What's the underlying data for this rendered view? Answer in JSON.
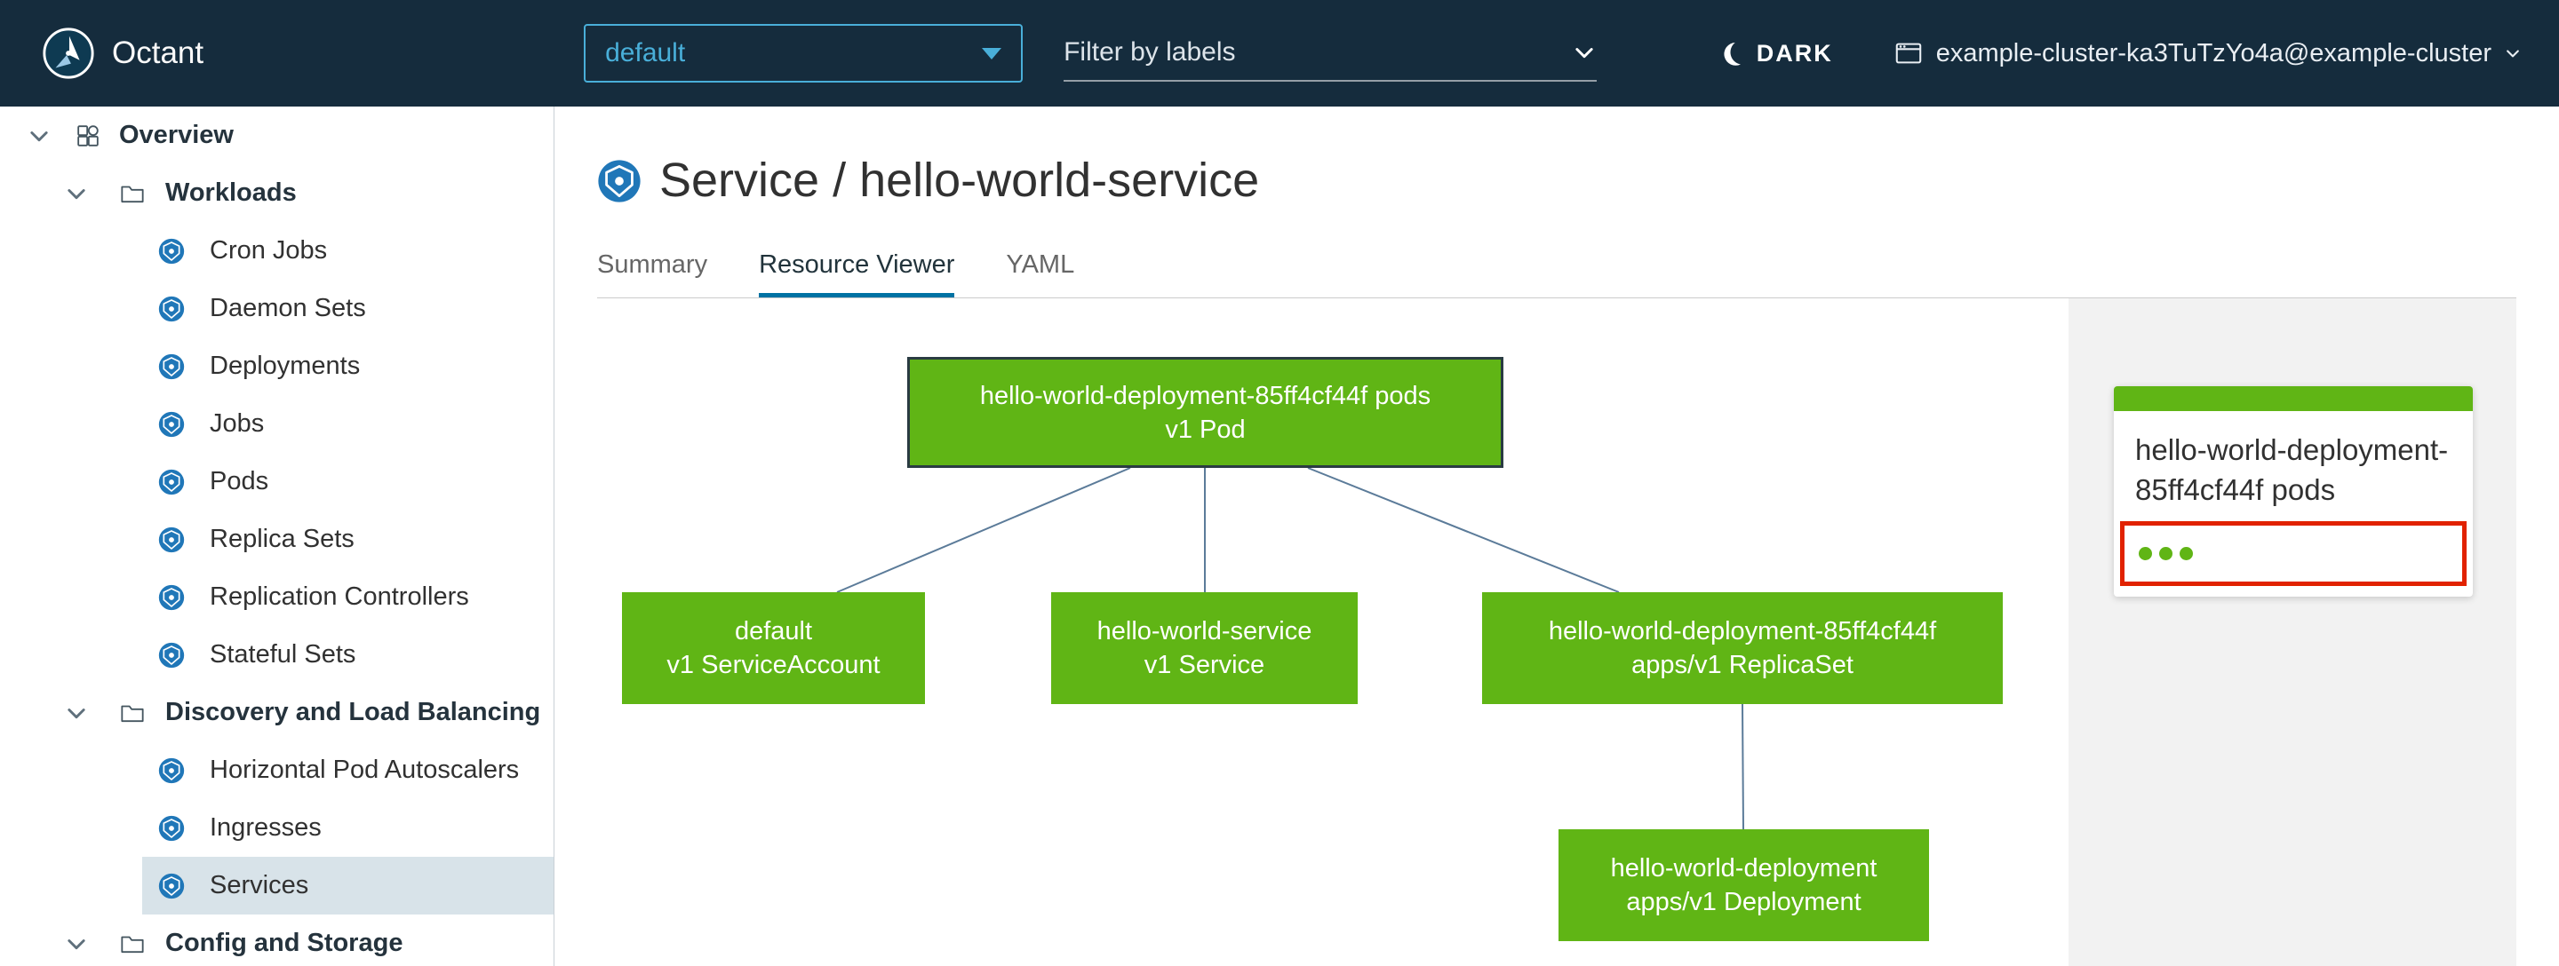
{
  "colors": {
    "header_bg": "#152c3d",
    "accent_blue": "#49afd9",
    "node_green": "#60b515",
    "selection_red": "#e12200",
    "tab_active_underline": "#0072a3",
    "sidebar_selected_bg": "#d8e3e9",
    "k8s_icon_blue": "#2077b8"
  },
  "header": {
    "app_name": "Octant",
    "namespace_dropdown": {
      "value": "default"
    },
    "filter": {
      "placeholder": "Filter by labels"
    },
    "theme_toggle_label": "DARK",
    "cluster_selector": "example-cluster-ka3TuTzYo4a@example-cluster"
  },
  "sidebar": {
    "items": [
      {
        "label": "Overview",
        "level": 0
      },
      {
        "label": "Workloads",
        "level": 1
      },
      {
        "label": "Cron Jobs",
        "level": 2
      },
      {
        "label": "Daemon Sets",
        "level": 2
      },
      {
        "label": "Deployments",
        "level": 2
      },
      {
        "label": "Jobs",
        "level": 2
      },
      {
        "label": "Pods",
        "level": 2
      },
      {
        "label": "Replica Sets",
        "level": 2
      },
      {
        "label": "Replication Controllers",
        "level": 2
      },
      {
        "label": "Stateful Sets",
        "level": 2
      },
      {
        "label": "Discovery and Load Balancing",
        "level": 1
      },
      {
        "label": "Horizontal Pod Autoscalers",
        "level": 2
      },
      {
        "label": "Ingresses",
        "level": 2
      },
      {
        "label": "Services",
        "level": 2,
        "selected": true
      },
      {
        "label": "Config and Storage",
        "level": 1
      }
    ]
  },
  "page": {
    "title": "Service / hello-world-service",
    "tabs": [
      {
        "label": "Summary",
        "active": false
      },
      {
        "label": "Resource Viewer",
        "active": true
      },
      {
        "label": "YAML",
        "active": false
      }
    ]
  },
  "graph": {
    "nodes": [
      {
        "name": "hello-world-deployment-85ff4cf44f pods",
        "kind": "v1 Pod",
        "selected": true
      },
      {
        "name": "default",
        "kind": "v1 ServiceAccount",
        "selected": false
      },
      {
        "name": "hello-world-service",
        "kind": "v1 Service",
        "selected": false
      },
      {
        "name": "hello-world-deployment-85ff4cf44f",
        "kind": "apps/v1 ReplicaSet",
        "selected": false
      },
      {
        "name": "hello-world-deployment",
        "kind": "apps/v1 Deployment",
        "selected": false
      }
    ]
  },
  "detail_panel": {
    "title": "hello-world-deployment-85ff4cf44f pods",
    "pod_status_dots": 3
  }
}
